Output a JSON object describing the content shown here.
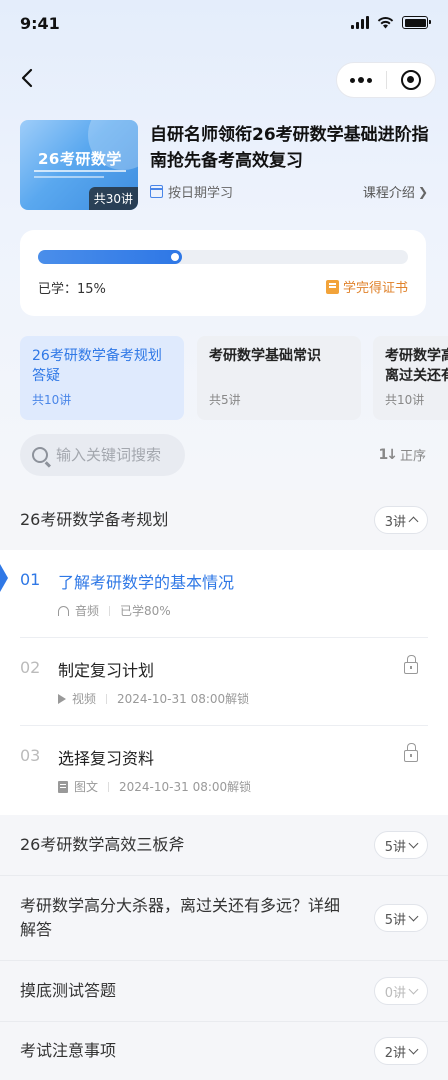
{
  "status_bar": {
    "time": "9:41"
  },
  "course": {
    "cover_title": "26考研数学",
    "cover_lessons": "共30讲",
    "title": "自研名师领衔26考研数学基础进阶指南抢先备考高效复习",
    "schedule_label": "按日期学习",
    "intro_label": "课程介绍"
  },
  "progress": {
    "percent": 15,
    "learned_label": "已学：15%",
    "certificate_label": "学完得证书"
  },
  "chapters": [
    {
      "title": "26考研数学备考规划答疑",
      "count": "共10讲"
    },
    {
      "title": "考研数学基础常识",
      "count": "共5讲"
    },
    {
      "title": "考研数学高分大杀器，离过关还有多远？",
      "count": "共10讲"
    }
  ],
  "search": {
    "placeholder": "输入关键词搜索"
  },
  "sort": {
    "label": "正序",
    "icon": "1↓"
  },
  "sections": [
    {
      "title": "26考研数学备考规划",
      "count": "3讲"
    },
    {
      "title": "26考研数学高效三板斧",
      "count": "5讲"
    },
    {
      "title": "考研数学高分大杀器，离过关还有多远？详细解答",
      "count": "5讲"
    },
    {
      "title": "摸底测试答题",
      "count": "0讲"
    },
    {
      "title": "考试注意事项",
      "count": "2讲"
    }
  ],
  "lessons": [
    {
      "num": "01",
      "title": "了解考研数学的基本情况",
      "type": "音频",
      "status": "已学80%",
      "type_icon": "headset-icon"
    },
    {
      "num": "02",
      "title": "制定复习计划",
      "type": "视频",
      "status": "2024-10-31 08:00解锁",
      "type_icon": "play-icon"
    },
    {
      "num": "03",
      "title": "选择复习资料",
      "type": "图文",
      "status": "2024-10-31 08:00解锁",
      "type_icon": "document-icon"
    }
  ],
  "colors": {
    "accent": "#2f78e6",
    "certificate": "#e0832c"
  }
}
